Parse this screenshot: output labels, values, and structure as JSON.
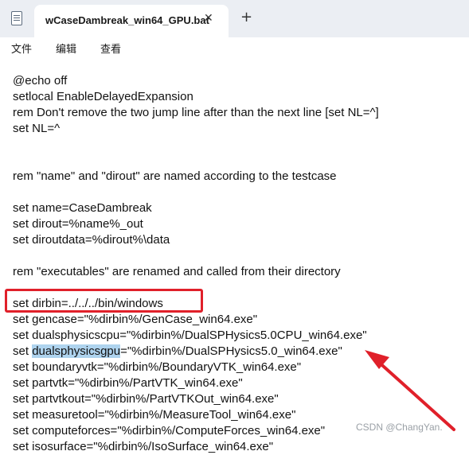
{
  "window": {
    "tab_title": "wCaseDambreak_win64_GPU.bat",
    "close_glyph": "✕",
    "new_tab_glyph": "+"
  },
  "menu": {
    "items": [
      "文件",
      "编辑",
      "查看"
    ]
  },
  "editor": {
    "lines": [
      "@echo off",
      "setlocal EnableDelayedExpansion",
      "rem Don't remove the two jump line after than the next line [set NL=^]",
      "set NL=^",
      "",
      "",
      "rem \"name\" and \"dirout\" are named according to the testcase",
      "",
      "set name=CaseDambreak",
      "set dirout=%name%_out",
      "set diroutdata=%dirout%\\data",
      "",
      "rem \"executables\" are renamed and called from their directory",
      "",
      "set dirbin=../../../bin/windows",
      "set gencase=\"%dirbin%/GenCase_win64.exe\"",
      "set dualsphysicscpu=\"%dirbin%/DualSPHysics5.0CPU_win64.exe\"",
      "set dualsphysicsgpu=\"%dirbin%/DualSPHysics5.0_win64.exe\"",
      "set boundaryvtk=\"%dirbin%/BoundaryVTK_win64.exe\"",
      "set partvtk=\"%dirbin%/PartVTK_win64.exe\"",
      "set partvtkout=\"%dirbin%/PartVTKOut_win64.exe\"",
      "set measuretool=\"%dirbin%/MeasureTool_win64.exe\"",
      "set computeforces=\"%dirbin%/ComputeForces_win64.exe\"",
      "set isosurface=\"%dirbin%/IsoSurface_win64.exe\""
    ],
    "selected_line": {
      "before": "set ",
      "selected": "dualsphysicsgpu",
      "after": "=\"%dirbin%/DualSPHysics5.0_win64.exe\""
    }
  },
  "annotations": {
    "highlight_color": "#e0202a",
    "selection_color": "#aed3ee"
  },
  "watermark": "CSDN @ChangYan."
}
